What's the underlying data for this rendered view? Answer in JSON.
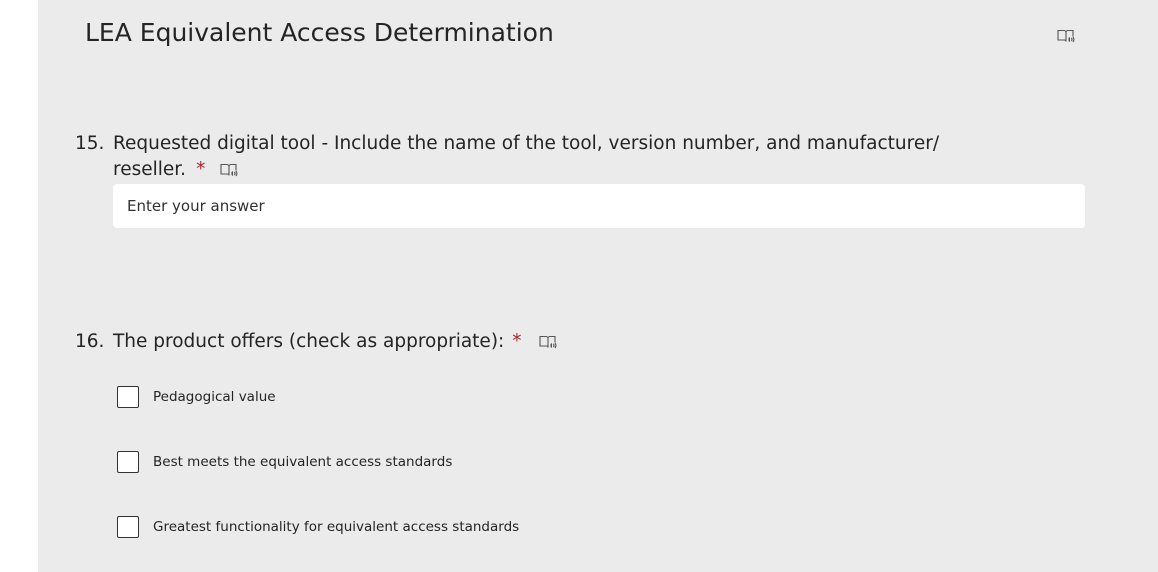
{
  "section": {
    "title": "LEA Equivalent Access Determination",
    "immersive_reader_icon": "immersive-reader-icon"
  },
  "questions": [
    {
      "number": "15.",
      "text_line1": "Requested digital tool - Include the name of the tool, version number, and manufacturer/",
      "text_line2": "reseller.",
      "required_marker": "*",
      "answer_value": "",
      "answer_placeholder": "Enter your answer"
    },
    {
      "number": "16.",
      "text": "The product offers (check as appropriate):",
      "required_marker": "*",
      "options": [
        {
          "label": "Pedagogical value",
          "checked": false
        },
        {
          "label": "Best meets the equivalent access standards",
          "checked": false
        },
        {
          "label": "Greatest functionality for equivalent access standards",
          "checked": false
        }
      ]
    }
  ],
  "colors": {
    "card_background": "#ebebeb",
    "required": "#a4262c",
    "text": "#242424"
  }
}
